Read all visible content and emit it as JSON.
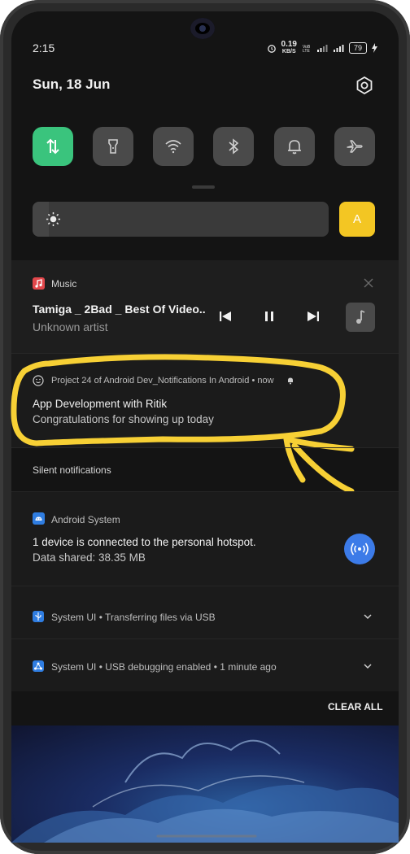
{
  "status_bar": {
    "time": "2:15",
    "net_speed": "0.19",
    "net_unit": "KB/S",
    "battery": "79"
  },
  "header": {
    "date": "Sun, 18 Jun"
  },
  "quick_settings": {
    "tiles": [
      {
        "name": "mobile-data",
        "active": true
      },
      {
        "name": "flashlight",
        "active": false
      },
      {
        "name": "wifi",
        "active": false
      },
      {
        "name": "bluetooth",
        "active": false
      },
      {
        "name": "sound",
        "active": false
      },
      {
        "name": "airplane-mode",
        "active": false
      }
    ],
    "brightness_level": 0.05,
    "auto_brightness_label": "A"
  },
  "music": {
    "app": "Music",
    "track": "Tamiga _ 2Bad _ Best Of Video..",
    "artist": "Unknown artist"
  },
  "notification_project": {
    "app": "Project 24 of Android Dev_Notifications In Android",
    "when": "now",
    "title": "App Development with Ritik",
    "text": "Congratulations for showing up today"
  },
  "silent_header": "Silent notifications",
  "android_system": {
    "app": "Android System",
    "line1": "1 device is connected to the personal hotspot.",
    "line2": "Data shared: 38.35 MB"
  },
  "system_ui_1": {
    "app": "System UI",
    "text": "Transferring files via USB"
  },
  "system_ui_2": {
    "app": "System UI",
    "text": "USB debugging enabled",
    "when": "1 minute ago"
  },
  "clear_all": "CLEAR ALL",
  "colors": {
    "accent_green": "#3ac47d",
    "auto_yellow": "#f3c623",
    "highlight_yellow": "#f7d035",
    "hotspot_blue": "#3c7be8"
  }
}
